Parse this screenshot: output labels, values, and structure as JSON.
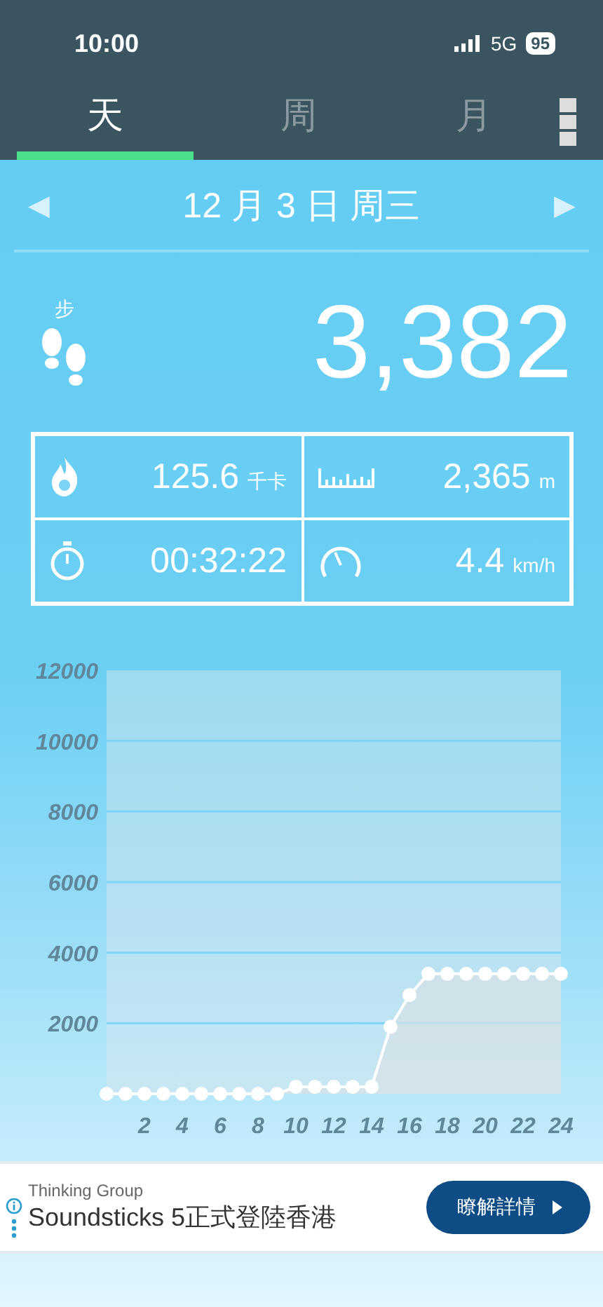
{
  "status_bar": {
    "time": "10:00",
    "network": "5G",
    "battery": "95"
  },
  "tabs": [
    {
      "label": "天",
      "selected": true
    },
    {
      "label": "周",
      "selected": false
    },
    {
      "label": "月",
      "selected": false
    }
  ],
  "date_nav": {
    "prev": "◀",
    "title": "12 月 3 日 周三",
    "next": "▶"
  },
  "steps": {
    "label": "步",
    "value": "3,382"
  },
  "stats": [
    {
      "kind": "calories",
      "value": "125.6",
      "unit": "千卡"
    },
    {
      "kind": "distance",
      "value": "2,365",
      "unit": "m"
    },
    {
      "kind": "duration",
      "value": "00:32:22"
    },
    {
      "kind": "speed",
      "value": "4.4",
      "unit": "km/h"
    }
  ],
  "chart_data": {
    "type": "area",
    "x": [
      0,
      1,
      2,
      3,
      4,
      5,
      6,
      7,
      8,
      9,
      10,
      11,
      12,
      13,
      14,
      15,
      16,
      17,
      18,
      19,
      20,
      21,
      22,
      23,
      24
    ],
    "series": [
      {
        "color": "#ffffff",
        "values": [
          0,
          0,
          0,
          0,
          0,
          0,
          0,
          0,
          0,
          0,
          200,
          200,
          200,
          200,
          200,
          1900,
          2800,
          3400,
          3400,
          3400,
          3400,
          3400,
          3400,
          3400,
          3400
        ]
      }
    ],
    "grid": true,
    "xlim": [
      0,
      24
    ],
    "ylim": [
      0,
      12000
    ],
    "xticks": [
      2,
      4,
      6,
      8,
      10,
      12,
      14,
      16,
      18,
      20,
      22,
      24
    ],
    "yticks": [
      2000,
      4000,
      6000,
      8000,
      10000,
      12000
    ]
  },
  "ad": {
    "sponsor": "Thinking Group",
    "headline": "Soundsticks 5正式登陸香港",
    "button": "瞭解詳情"
  }
}
